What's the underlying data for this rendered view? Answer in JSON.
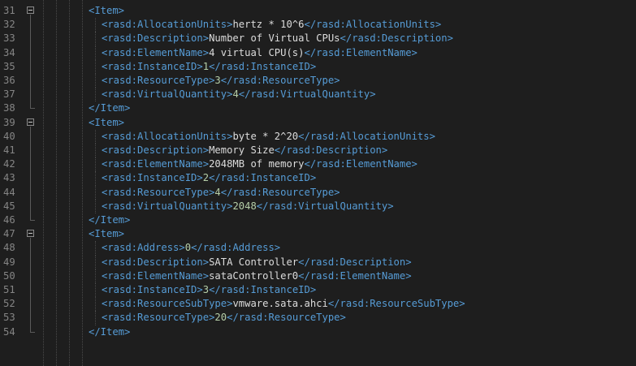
{
  "editor": {
    "lines": [
      {
        "no": "31",
        "indent": 0,
        "fold": true,
        "open": "<Item>"
      },
      {
        "no": "32",
        "indent": 1,
        "open": "<rasd:AllocationUnits>",
        "value": "hertz * 10^6",
        "close": "</rasd:AllocationUnits>"
      },
      {
        "no": "33",
        "indent": 1,
        "open": "<rasd:Description>",
        "value": "Number of Virtual CPUs",
        "close": "</rasd:Description>"
      },
      {
        "no": "34",
        "indent": 1,
        "open": "<rasd:ElementName>",
        "value": "4 virtual CPU(s)",
        "close": "</rasd:ElementName>"
      },
      {
        "no": "35",
        "indent": 1,
        "open": "<rasd:InstanceID>",
        "value": "1",
        "close": "</rasd:InstanceID>"
      },
      {
        "no": "36",
        "indent": 1,
        "open": "<rasd:ResourceType>",
        "value": "3",
        "close": "</rasd:ResourceType>"
      },
      {
        "no": "37",
        "indent": 1,
        "open": "<rasd:VirtualQuantity>",
        "value": "4",
        "close": "</rasd:VirtualQuantity>"
      },
      {
        "no": "38",
        "indent": 0,
        "open": "</Item>"
      },
      {
        "no": "39",
        "indent": 0,
        "fold": true,
        "open": "<Item>"
      },
      {
        "no": "40",
        "indent": 1,
        "open": "<rasd:AllocationUnits>",
        "value": "byte * 2^20",
        "close": "</rasd:AllocationUnits>"
      },
      {
        "no": "41",
        "indent": 1,
        "open": "<rasd:Description>",
        "value": "Memory Size",
        "close": "</rasd:Description>"
      },
      {
        "no": "42",
        "indent": 1,
        "open": "<rasd:ElementName>",
        "value": "2048MB of memory",
        "close": "</rasd:ElementName>"
      },
      {
        "no": "43",
        "indent": 1,
        "open": "<rasd:InstanceID>",
        "value": "2",
        "close": "</rasd:InstanceID>"
      },
      {
        "no": "44",
        "indent": 1,
        "open": "<rasd:ResourceType>",
        "value": "4",
        "close": "</rasd:ResourceType>"
      },
      {
        "no": "45",
        "indent": 1,
        "open": "<rasd:VirtualQuantity>",
        "value": "2048",
        "close": "</rasd:VirtualQuantity>"
      },
      {
        "no": "46",
        "indent": 0,
        "open": "</Item>"
      },
      {
        "no": "47",
        "indent": 0,
        "fold": true,
        "open": "<Item>"
      },
      {
        "no": "48",
        "indent": 1,
        "open": "<rasd:Address>",
        "value": "0",
        "close": "</rasd:Address>"
      },
      {
        "no": "49",
        "indent": 1,
        "open": "<rasd:Description>",
        "value": "SATA Controller",
        "close": "</rasd:Description>"
      },
      {
        "no": "50",
        "indent": 1,
        "open": "<rasd:ElementName>",
        "value": "sataController0",
        "close": "</rasd:ElementName>"
      },
      {
        "no": "51",
        "indent": 1,
        "open": "<rasd:InstanceID>",
        "value": "3",
        "close": "</rasd:InstanceID>"
      },
      {
        "no": "52",
        "indent": 1,
        "open": "<rasd:ResourceSubType>",
        "value": "vmware.sata.ahci",
        "close": "</rasd:ResourceSubType>"
      },
      {
        "no": "53",
        "indent": 1,
        "open": "<rasd:ResourceType>",
        "value": "20",
        "close": "</rasd:ResourceType>"
      },
      {
        "no": "54",
        "indent": 0,
        "open": "</Item>"
      }
    ]
  },
  "colors": {
    "background": "#1e1e1e",
    "line_number": "#858585",
    "tag": "#569cd6",
    "text": "#dcdcdc",
    "numeric": "#b5cea8"
  }
}
